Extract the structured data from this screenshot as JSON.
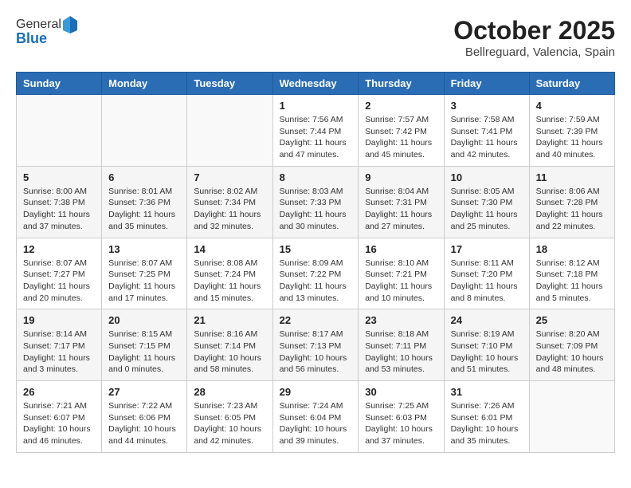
{
  "header": {
    "logo_general": "General",
    "logo_blue": "Blue",
    "month": "October 2025",
    "location": "Bellreguard, Valencia, Spain"
  },
  "columns": [
    "Sunday",
    "Monday",
    "Tuesday",
    "Wednesday",
    "Thursday",
    "Friday",
    "Saturday"
  ],
  "rows": [
    [
      {
        "day": "",
        "info": ""
      },
      {
        "day": "",
        "info": ""
      },
      {
        "day": "",
        "info": ""
      },
      {
        "day": "1",
        "info": "Sunrise: 7:56 AM\nSunset: 7:44 PM\nDaylight: 11 hours and 47 minutes."
      },
      {
        "day": "2",
        "info": "Sunrise: 7:57 AM\nSunset: 7:42 PM\nDaylight: 11 hours and 45 minutes."
      },
      {
        "day": "3",
        "info": "Sunrise: 7:58 AM\nSunset: 7:41 PM\nDaylight: 11 hours and 42 minutes."
      },
      {
        "day": "4",
        "info": "Sunrise: 7:59 AM\nSunset: 7:39 PM\nDaylight: 11 hours and 40 minutes."
      }
    ],
    [
      {
        "day": "5",
        "info": "Sunrise: 8:00 AM\nSunset: 7:38 PM\nDaylight: 11 hours and 37 minutes."
      },
      {
        "day": "6",
        "info": "Sunrise: 8:01 AM\nSunset: 7:36 PM\nDaylight: 11 hours and 35 minutes."
      },
      {
        "day": "7",
        "info": "Sunrise: 8:02 AM\nSunset: 7:34 PM\nDaylight: 11 hours and 32 minutes."
      },
      {
        "day": "8",
        "info": "Sunrise: 8:03 AM\nSunset: 7:33 PM\nDaylight: 11 hours and 30 minutes."
      },
      {
        "day": "9",
        "info": "Sunrise: 8:04 AM\nSunset: 7:31 PM\nDaylight: 11 hours and 27 minutes."
      },
      {
        "day": "10",
        "info": "Sunrise: 8:05 AM\nSunset: 7:30 PM\nDaylight: 11 hours and 25 minutes."
      },
      {
        "day": "11",
        "info": "Sunrise: 8:06 AM\nSunset: 7:28 PM\nDaylight: 11 hours and 22 minutes."
      }
    ],
    [
      {
        "day": "12",
        "info": "Sunrise: 8:07 AM\nSunset: 7:27 PM\nDaylight: 11 hours and 20 minutes."
      },
      {
        "day": "13",
        "info": "Sunrise: 8:07 AM\nSunset: 7:25 PM\nDaylight: 11 hours and 17 minutes."
      },
      {
        "day": "14",
        "info": "Sunrise: 8:08 AM\nSunset: 7:24 PM\nDaylight: 11 hours and 15 minutes."
      },
      {
        "day": "15",
        "info": "Sunrise: 8:09 AM\nSunset: 7:22 PM\nDaylight: 11 hours and 13 minutes."
      },
      {
        "day": "16",
        "info": "Sunrise: 8:10 AM\nSunset: 7:21 PM\nDaylight: 11 hours and 10 minutes."
      },
      {
        "day": "17",
        "info": "Sunrise: 8:11 AM\nSunset: 7:20 PM\nDaylight: 11 hours and 8 minutes."
      },
      {
        "day": "18",
        "info": "Sunrise: 8:12 AM\nSunset: 7:18 PM\nDaylight: 11 hours and 5 minutes."
      }
    ],
    [
      {
        "day": "19",
        "info": "Sunrise: 8:14 AM\nSunset: 7:17 PM\nDaylight: 11 hours and 3 minutes."
      },
      {
        "day": "20",
        "info": "Sunrise: 8:15 AM\nSunset: 7:15 PM\nDaylight: 11 hours and 0 minutes."
      },
      {
        "day": "21",
        "info": "Sunrise: 8:16 AM\nSunset: 7:14 PM\nDaylight: 10 hours and 58 minutes."
      },
      {
        "day": "22",
        "info": "Sunrise: 8:17 AM\nSunset: 7:13 PM\nDaylight: 10 hours and 56 minutes."
      },
      {
        "day": "23",
        "info": "Sunrise: 8:18 AM\nSunset: 7:11 PM\nDaylight: 10 hours and 53 minutes."
      },
      {
        "day": "24",
        "info": "Sunrise: 8:19 AM\nSunset: 7:10 PM\nDaylight: 10 hours and 51 minutes."
      },
      {
        "day": "25",
        "info": "Sunrise: 8:20 AM\nSunset: 7:09 PM\nDaylight: 10 hours and 48 minutes."
      }
    ],
    [
      {
        "day": "26",
        "info": "Sunrise: 7:21 AM\nSunset: 6:07 PM\nDaylight: 10 hours and 46 minutes."
      },
      {
        "day": "27",
        "info": "Sunrise: 7:22 AM\nSunset: 6:06 PM\nDaylight: 10 hours and 44 minutes."
      },
      {
        "day": "28",
        "info": "Sunrise: 7:23 AM\nSunset: 6:05 PM\nDaylight: 10 hours and 42 minutes."
      },
      {
        "day": "29",
        "info": "Sunrise: 7:24 AM\nSunset: 6:04 PM\nDaylight: 10 hours and 39 minutes."
      },
      {
        "day": "30",
        "info": "Sunrise: 7:25 AM\nSunset: 6:03 PM\nDaylight: 10 hours and 37 minutes."
      },
      {
        "day": "31",
        "info": "Sunrise: 7:26 AM\nSunset: 6:01 PM\nDaylight: 10 hours and 35 minutes."
      },
      {
        "day": "",
        "info": ""
      }
    ]
  ]
}
